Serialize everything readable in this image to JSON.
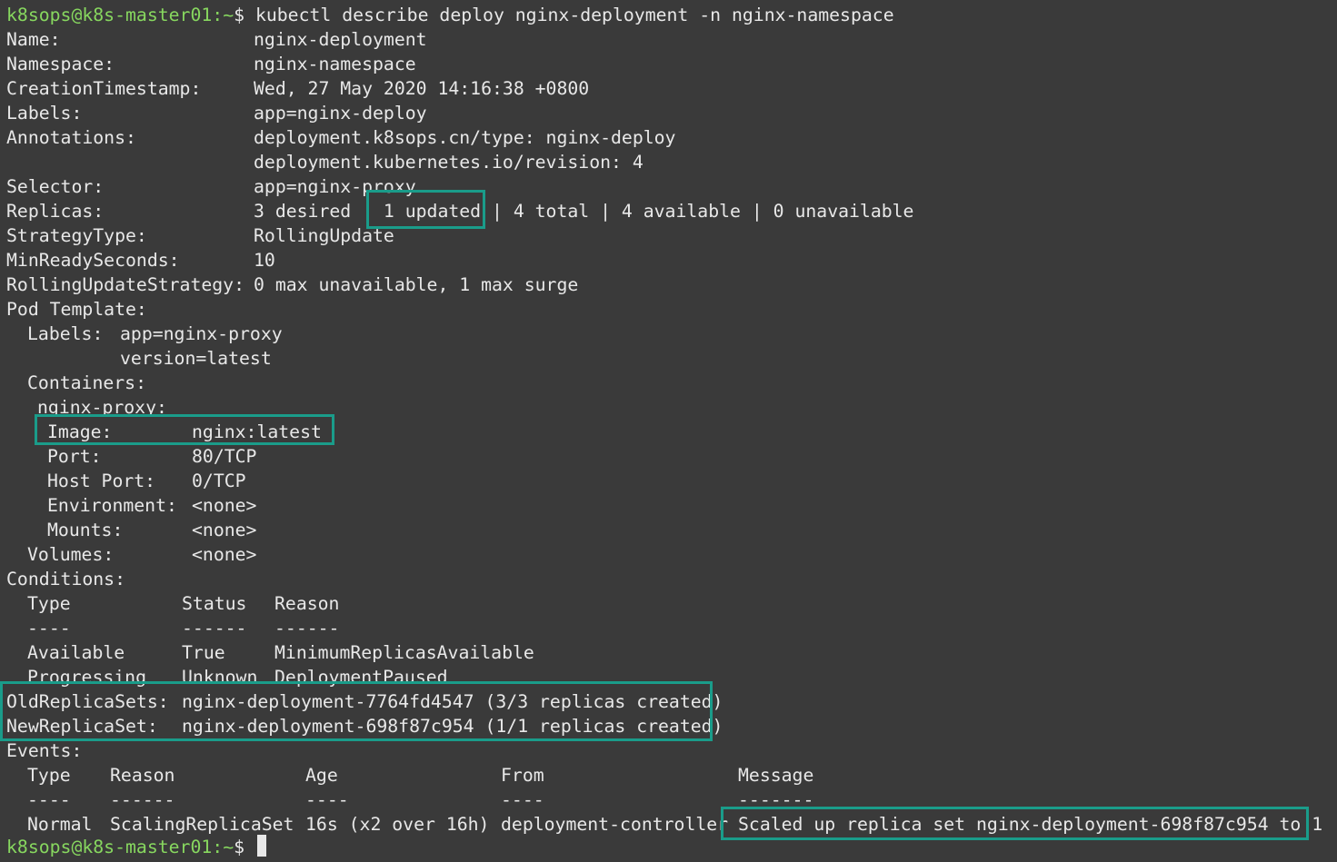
{
  "prompt": {
    "user_host": "k8sops@k8s-master01",
    "path": ":~",
    "symbol": "$",
    "command": "kubectl describe deploy nginx-deployment -n nginx-namespace"
  },
  "fields": {
    "name": {
      "key": "Name:",
      "value": "nginx-deployment"
    },
    "namespace": {
      "key": "Namespace:",
      "value": "nginx-namespace"
    },
    "creation": {
      "key": "CreationTimestamp:",
      "value": "Wed, 27 May 2020 14:16:38 +0800"
    },
    "labels": {
      "key": "Labels:",
      "value": "app=nginx-deploy"
    },
    "annotations": {
      "key": "Annotations:",
      "value1": "deployment.k8sops.cn/type: nginx-deploy",
      "value2": "deployment.kubernetes.io/revision: 4"
    },
    "selector": {
      "key": "Selector:",
      "value": "app=nginx-proxy"
    },
    "replicas": {
      "key": "Replicas:",
      "value": "3 desired | 1 updated | 4 total | 4 available | 0 unavailable"
    },
    "strategy": {
      "key": "StrategyType:",
      "value": "RollingUpdate"
    },
    "minready": {
      "key": "MinReadySeconds:",
      "value": "10"
    },
    "rolling": {
      "key": "RollingUpdateStrategy:",
      "value": "0 max unavailable, 1 max surge"
    }
  },
  "pod_template": {
    "header": "Pod Template:",
    "labels_key": "Labels:",
    "labels_v1": "app=nginx-proxy",
    "labels_v2": "version=latest",
    "containers_header": "Containers:",
    "container_name": "nginx-proxy:",
    "image": {
      "key": "Image:",
      "value": "nginx:latest"
    },
    "port": {
      "key": "Port:",
      "value": "80/TCP"
    },
    "host_port": {
      "key": "Host Port:",
      "value": "0/TCP"
    },
    "environment": {
      "key": "Environment:",
      "value": "<none>"
    },
    "mounts": {
      "key": "Mounts:",
      "value": "<none>"
    },
    "volumes": {
      "key": "Volumes:",
      "value": "<none>"
    }
  },
  "conditions": {
    "header": "Conditions:",
    "columns": [
      "Type",
      "Status",
      "Reason"
    ],
    "dashes": [
      "----",
      "------",
      "------"
    ],
    "rows": [
      [
        "Available",
        "True",
        "MinimumReplicasAvailable"
      ],
      [
        "Progressing",
        "Unknown",
        "DeploymentPaused"
      ]
    ]
  },
  "replica_sets": {
    "old": {
      "key": "OldReplicaSets:",
      "value": "nginx-deployment-7764fd4547 (3/3 replicas created)"
    },
    "new": {
      "key": "NewReplicaSet:",
      "value": "nginx-deployment-698f87c954 (1/1 replicas created)"
    }
  },
  "events": {
    "header": "Events:",
    "columns": [
      "Type",
      "Reason",
      "Age",
      "From",
      "Message"
    ],
    "dashes": [
      "----",
      "------",
      "----",
      "----",
      "-------"
    ],
    "rows": [
      [
        "Normal",
        "ScalingReplicaSet",
        "16s (x2 over 16h)",
        "deployment-controller",
        "Scaled up replica set nginx-deployment-698f87c954 to 1"
      ]
    ]
  },
  "colors": {
    "background": "#3a3a3a",
    "text": "#e8e8e8",
    "prompt": "#87d75f",
    "highlight_box": "#1a9c8a"
  }
}
